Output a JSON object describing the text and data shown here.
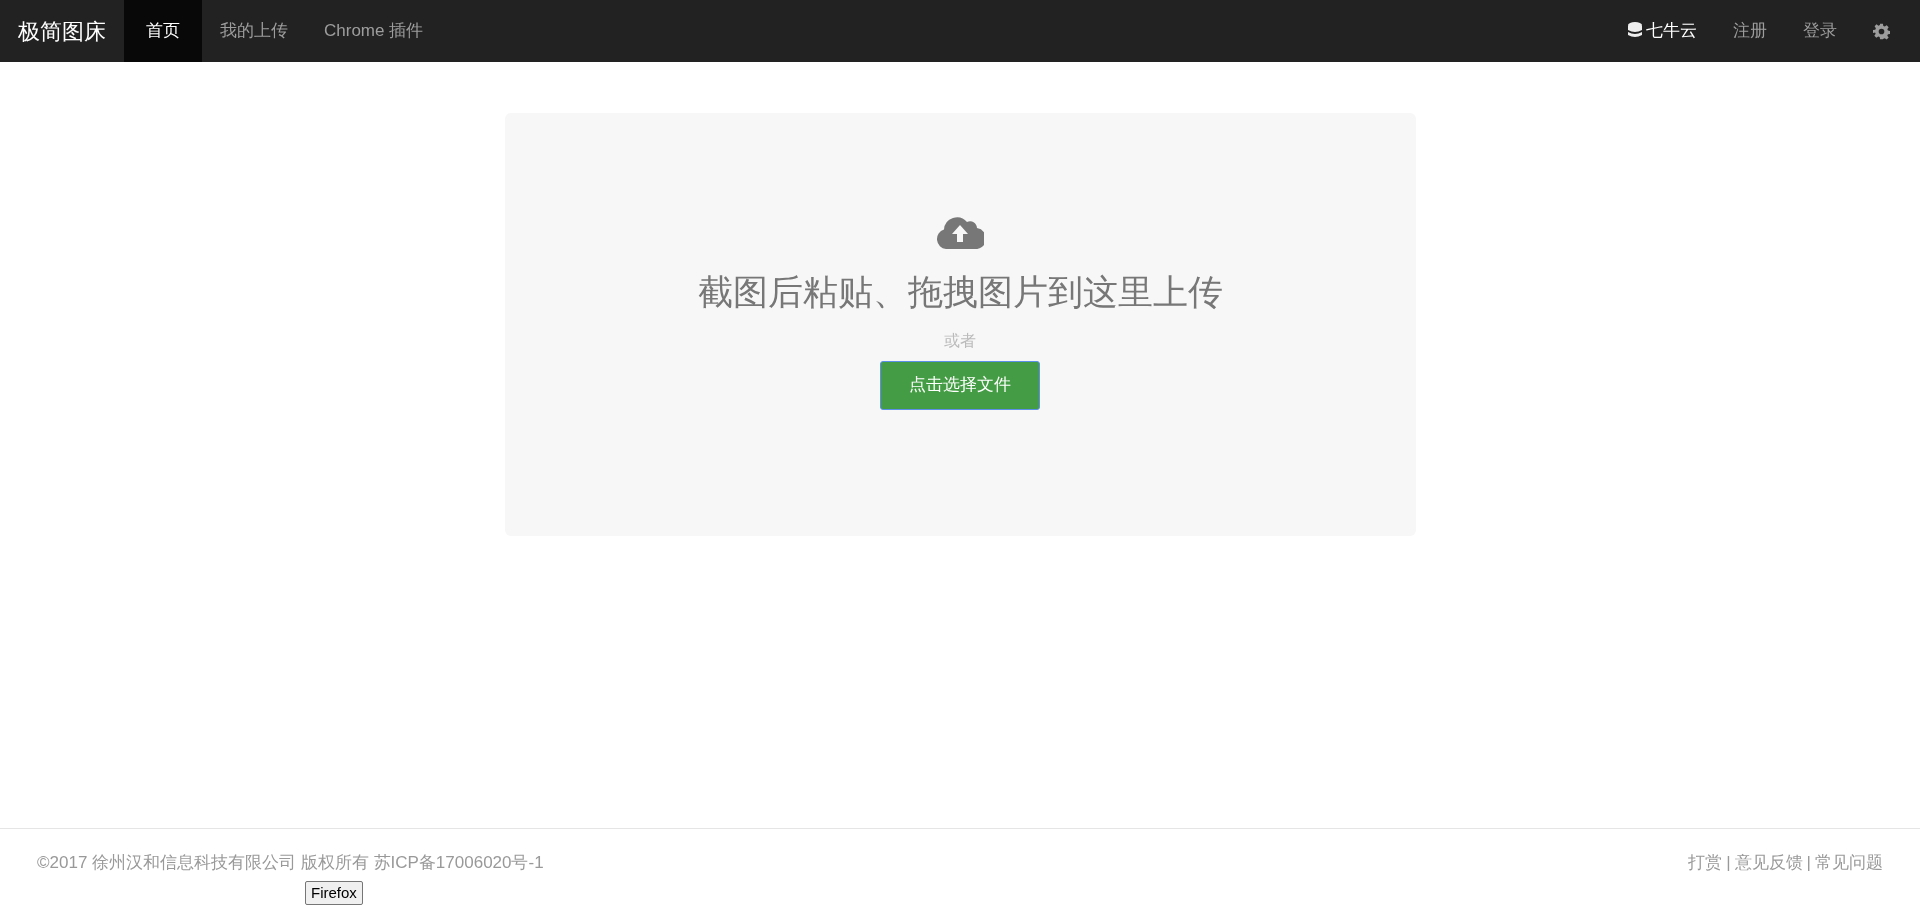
{
  "navbar": {
    "brand": "极简图床",
    "left_items": [
      {
        "label": "首页",
        "selected": true
      },
      {
        "label": "我的上传",
        "selected": false
      },
      {
        "label": "Chrome 插件",
        "selected": false
      }
    ],
    "right_items": [
      {
        "kind": "storage",
        "label": "七牛云"
      },
      {
        "kind": "link",
        "label": "注册"
      },
      {
        "kind": "link",
        "label": "登录"
      },
      {
        "kind": "settings"
      }
    ]
  },
  "upload_area": {
    "heading": "截图后粘贴、拖拽图片到这里上传",
    "separator_text": "或者",
    "button": "点击选择文件"
  },
  "footer": {
    "copyright": "©2017 徐州汉和信息科技有限公司 版权所有 苏ICP备17006020号-1",
    "links": [
      "打赏",
      "意见反馈",
      "常见问题"
    ],
    "link_separator": "|"
  },
  "tooltip": "Firefox"
}
